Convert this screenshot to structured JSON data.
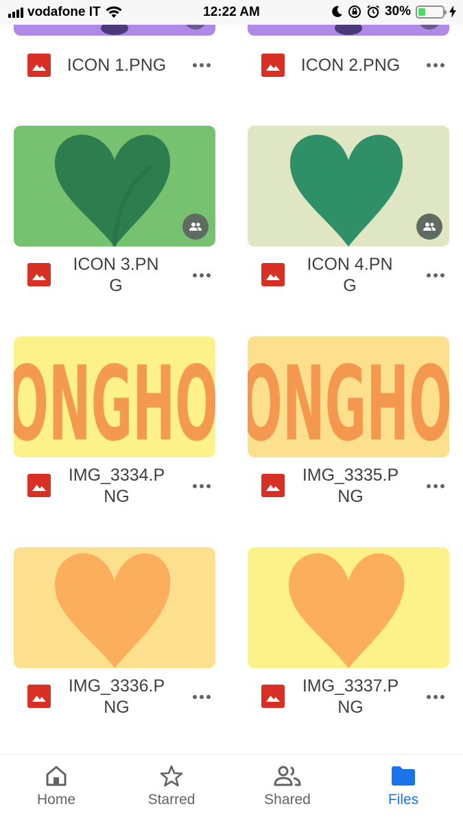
{
  "status_bar": {
    "carrier": "vodafone IT",
    "time": "12:22 AM",
    "battery_percent": "30%",
    "battery_level": 0.3
  },
  "files": [
    {
      "name": "ICON 1.PNG",
      "type_icon": "image-file-icon",
      "shared": false
    },
    {
      "name": "ICON 2.PNG",
      "type_icon": "image-file-icon",
      "shared": false
    },
    {
      "name": "ICON 3.PNG",
      "type_icon": "image-file-icon",
      "shared": true
    },
    {
      "name": "ICON 4.PNG",
      "type_icon": "image-file-icon",
      "shared": true
    },
    {
      "name": "IMG_3334.PNG",
      "type_icon": "image-file-icon",
      "shared": false
    },
    {
      "name": "IMG_3335.PNG",
      "type_icon": "image-file-icon",
      "shared": false
    },
    {
      "name": "IMG_3336.PNG",
      "type_icon": "image-file-icon",
      "shared": false
    },
    {
      "name": "IMG_3337.PNG",
      "type_icon": "image-file-icon",
      "shared": false
    }
  ],
  "bottom_nav": {
    "items": [
      {
        "label": "Home",
        "icon": "home-icon",
        "active": false
      },
      {
        "label": "Starred",
        "icon": "star-icon",
        "active": false
      },
      {
        "label": "Shared",
        "icon": "people-icon",
        "active": false
      },
      {
        "label": "Files",
        "icon": "folder-icon",
        "active": true
      }
    ]
  },
  "colors": {
    "accent": "#1a73e8",
    "image_icon_red": "#d93025",
    "thumb_green": "#77c271",
    "thumb_pale_green": "#dfe6c4",
    "thumb_yellow": "#fdf18a",
    "thumb_light_orange": "#fde08e",
    "thumb_purple": "#b088e8"
  }
}
